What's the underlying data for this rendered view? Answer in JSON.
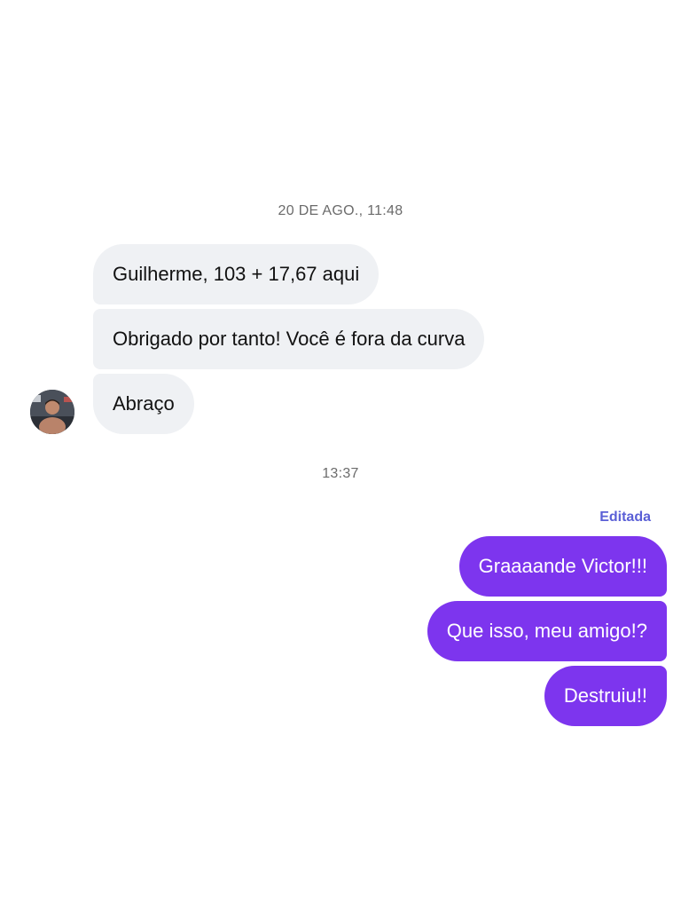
{
  "conversation": {
    "groups": [
      {
        "timestamp": "20 DE AGO., 11:48",
        "sender": "them",
        "messages": [
          "Guilherme, 103 + 17,67 aqui",
          "Obrigado por tanto! Você é fora da curva",
          "Abraço"
        ]
      },
      {
        "timestamp": "13:37",
        "sender": "me",
        "edited_label": "Editada",
        "messages": [
          "Graaaande Victor!!!",
          "Que isso, meu amigo!?",
          "Destruiu!!"
        ]
      }
    ]
  },
  "colors": {
    "incoming_bubble": "#eff1f4",
    "outgoing_bubble": "#7d35ee",
    "edited_label": "#5a5fd6",
    "timestamp": "#6b6b6b"
  },
  "icons": {
    "avatar": "contact-avatar"
  }
}
